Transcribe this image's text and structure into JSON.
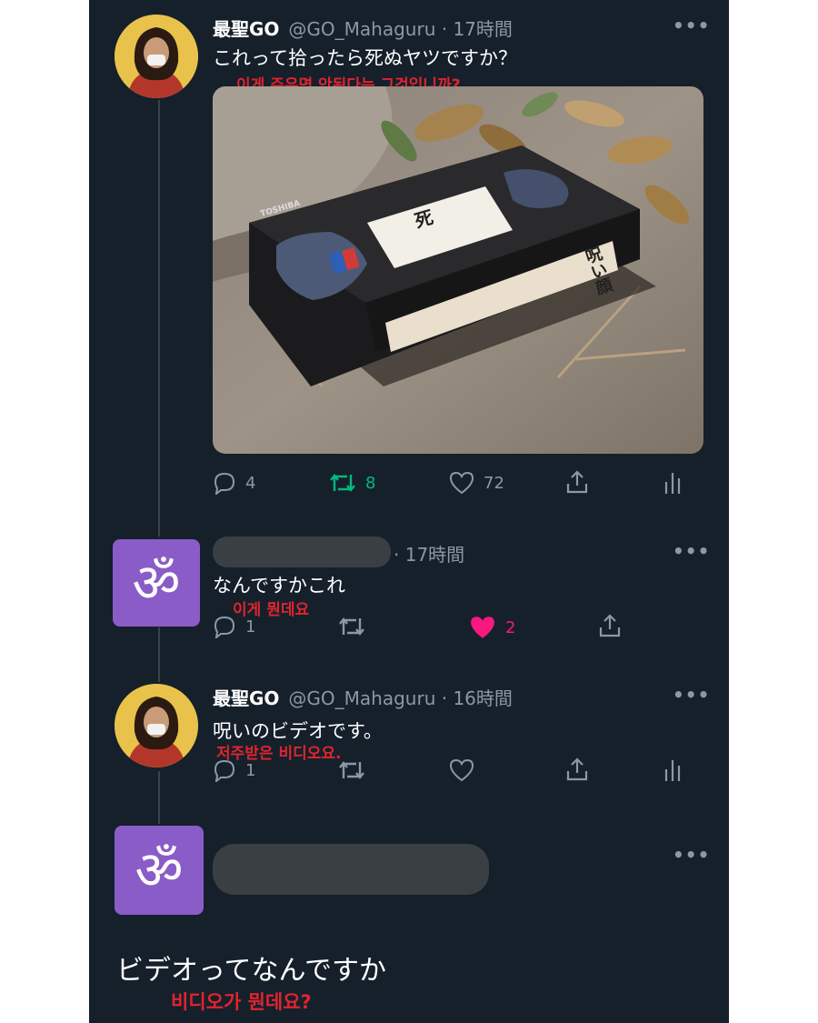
{
  "tweet1": {
    "display_name": "最聖GO",
    "handle_time": "@GO_Mahaguru · 17時間",
    "text": "これって拾ったら死ぬヤツですか？",
    "translation": "이게  주우면  안된다는  그것입니까?",
    "media": {
      "tape_label_title": "死",
      "tape_label_side": "呪い顔",
      "tape_brand": "TOSHIBA"
    },
    "replies": "4",
    "retweets": "8",
    "likes": "72"
  },
  "tweet2": {
    "time": "· 17時間",
    "text": "なんですかこれ",
    "translation": "이게  뭔데요",
    "replies": "1",
    "likes": "2"
  },
  "tweet3": {
    "display_name": "最聖GO",
    "handle_time": "@GO_Mahaguru · 16時間",
    "text": "呪いのビデオです。",
    "translation": "저주받은  비디오요.",
    "replies": "1"
  },
  "tweet4": {
    "text": "ビデオってなんですか",
    "translation": "비디오가  뭔데요?"
  },
  "more_icon": "•••",
  "om_symbol": "ॐ",
  "colors": {
    "background": "#15202b",
    "secondary_text": "#8b98a5",
    "retweet_green": "#00ba7c",
    "like_pink": "#f91880",
    "translation_red": "#e0242e",
    "avatar_purple": "#8a5cc8"
  }
}
